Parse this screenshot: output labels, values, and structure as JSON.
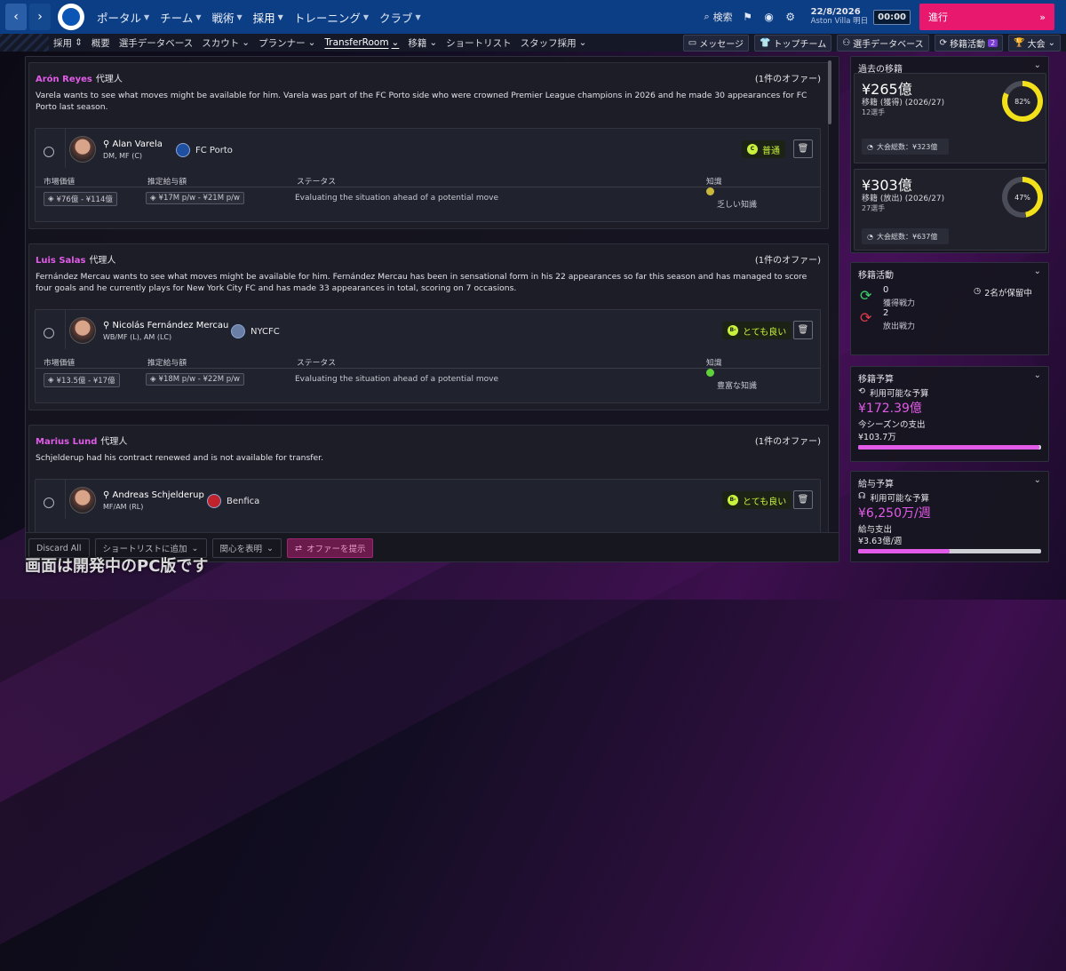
{
  "topbar": {
    "menu": [
      {
        "label": "ポータル",
        "has_chevron": true
      },
      {
        "label": "チーム",
        "has_chevron": true
      },
      {
        "label": "戦術",
        "has_chevron": true
      },
      {
        "label": "採用",
        "has_chevron": true
      },
      {
        "label": "トレーニング",
        "has_chevron": true
      },
      {
        "label": "クラブ",
        "has_chevron": true
      }
    ],
    "search_label": "検索",
    "date": "22/8/2026",
    "club_name": "Aston Villa",
    "day_label": "明日",
    "time": "00:00",
    "proceed_label": "進行",
    "proceed_color": "#e8186f",
    "bar_color": "#0b3e85"
  },
  "subbar": {
    "section_label": "採用",
    "items": [
      "概要",
      "選手データベース",
      "スカウト",
      "プランナー",
      "TransferRoom",
      "移籍",
      "ショートリスト",
      "スタッフ採用"
    ],
    "active_item": "TransferRoom",
    "right_pills": [
      "メッセージ",
      "トップチーム",
      "選手データベース",
      "移籍活動",
      "大会"
    ],
    "transfer_badge": "2"
  },
  "agents": [
    {
      "name": "Arón Reyes",
      "role": "代理人",
      "offer_count": "(1件のオファー)",
      "description": "Varela wants to see what moves might be available for him. Varela was part of the FC Porto side who were crowned Premier League champions in 2026 and he made 30 appearances for FC Porto last season.",
      "player": {
        "name": "Alan Varela",
        "position": "DM, MF (C)",
        "club": "FC Porto",
        "rating_letter": "C",
        "rating_label": "普通",
        "col_headers": [
          "市場価値",
          "推定給与額",
          "ステータス",
          "知識"
        ],
        "market_value": "¥76億 - ¥114億",
        "wage": "¥17M p/w - ¥21M p/w",
        "status": "Evaluating the situation ahead of a potential move",
        "knowledge": "乏しい知識",
        "knowledge_color": "#c8b93a"
      }
    },
    {
      "name": "Luis Salas",
      "role": "代理人",
      "offer_count": "(1件のオファー)",
      "description": "Fernández Mercau wants to see what moves might be available for him. Fernández Mercau has been in sensational form in his 22 appearances so far this season and has managed to score four goals and he currently plays for New York City FC and has made 33 appearances in total, scoring on 7 occasions.",
      "player": {
        "name": "Nicolás Fernández Mercau",
        "position": "WB/MF (L), AM (LC)",
        "club": "NYCFC",
        "rating_letter": "B-",
        "rating_label": "とても良い",
        "col_headers": [
          "市場価値",
          "推定給与額",
          "ステータス",
          "知識"
        ],
        "market_value": "¥13.5億 - ¥17億",
        "wage": "¥18M p/w - ¥22M p/w",
        "status": "Evaluating the situation ahead of a potential move",
        "knowledge": "豊富な知識",
        "knowledge_color": "#5fd13a"
      }
    },
    {
      "name": "Marius Lund",
      "role": "代理人",
      "offer_count": "(1件のオファー)",
      "description": "Schjelderup had his contract renewed and is not available for transfer.",
      "player": {
        "name": "Andreas Schjelderup",
        "position": "MF/AM (RL)",
        "club": "Benfica",
        "rating_letter": "B-",
        "rating_label": "とても良い"
      }
    }
  ],
  "actions": {
    "discard_all": "Discard All",
    "add_shortlist": "ショートリストに追加",
    "show_interest": "関心を表明",
    "make_offer": "オファーを提示"
  },
  "watermark": "画面は開発中のPC版です",
  "past_transfers": {
    "title": "過去の移籍",
    "in": {
      "amount": "¥265億",
      "label": "移籍 (獲得) (2026/27)",
      "count": "12選手",
      "percent": 82,
      "percent_label": "82%",
      "total_label": "大会総数：¥323億"
    },
    "out": {
      "amount": "¥303億",
      "label": "移籍 (放出) (2026/27)",
      "count": "27選手",
      "percent": 47,
      "percent_label": "47%",
      "total_label": "大会総数：¥637億"
    },
    "ring_color": "#f2e01a"
  },
  "transfer_activity": {
    "title": "移籍活動",
    "in_count": "0",
    "in_label": "獲得戦力",
    "out_count": "2",
    "out_label": "放出戦力",
    "pending": "2名が保留中"
  },
  "transfer_budget": {
    "title": "移籍予算",
    "available_label": "利用可能な予算",
    "available": "¥172.39億",
    "spent_label": "今シーズンの支出",
    "spent": "¥103.7万",
    "fill": 0.99
  },
  "wage_budget": {
    "title": "給与予算",
    "available_label": "利用可能な予算",
    "available": "¥6,250万/週",
    "spent_label": "給与支出",
    "spent": "¥3.63億/週",
    "fill": 0.5
  }
}
